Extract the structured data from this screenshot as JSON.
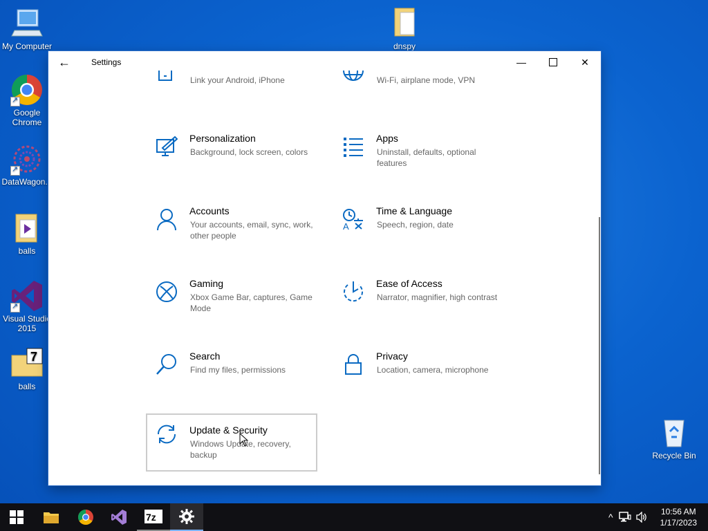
{
  "desktop": {
    "icons": [
      {
        "label": "My Computer"
      },
      {
        "label": "Google Chrome"
      },
      {
        "label": "DataWagon..."
      },
      {
        "label": "balls"
      },
      {
        "label": "Visual Studio 2015"
      },
      {
        "label": "balls"
      },
      {
        "label": "dnspy"
      },
      {
        "label": "Recycle Bin"
      }
    ]
  },
  "window": {
    "title": "Settings",
    "back_label": "←",
    "minimize_label": "—",
    "close_label": "✕"
  },
  "settings": {
    "partial": [
      {
        "desc": "Link your Android, iPhone",
        "icon": "phone-icon"
      },
      {
        "desc": "Wi-Fi, airplane mode, VPN",
        "icon": "globe-icon"
      }
    ],
    "tiles": [
      {
        "name": "Personalization",
        "desc": "Background, lock screen, colors",
        "icon": "paintbrush-icon"
      },
      {
        "name": "Apps",
        "desc": "Uninstall, defaults, optional features",
        "icon": "apps-list-icon"
      },
      {
        "name": "Accounts",
        "desc": "Your accounts, email, sync, work, other people",
        "icon": "person-icon"
      },
      {
        "name": "Time & Language",
        "desc": "Speech, region, date",
        "icon": "time-language-icon"
      },
      {
        "name": "Gaming",
        "desc": "Xbox Game Bar, captures, Game Mode",
        "icon": "xbox-icon"
      },
      {
        "name": "Ease of Access",
        "desc": "Narrator, magnifier, high contrast",
        "icon": "ease-of-access-icon"
      },
      {
        "name": "Search",
        "desc": "Find my files, permissions",
        "icon": "search-icon"
      },
      {
        "name": "Privacy",
        "desc": "Location, camera, microphone",
        "icon": "lock-icon"
      },
      {
        "name": "Update & Security",
        "desc": "Windows Update, recovery, backup",
        "icon": "sync-icon"
      }
    ]
  },
  "taskbar": {
    "apps": [
      "file-explorer-icon",
      "chrome-icon",
      "visual-studio-icon",
      "7zip-icon",
      "settings-gear-icon"
    ],
    "tray": {
      "chevron": "^"
    },
    "clock": {
      "time": "10:56 AM",
      "date": "1/17/2023"
    }
  },
  "colors": {
    "accent": "#0a6ac2",
    "desktop": "#0b63cf",
    "taskbar": "#101014"
  }
}
